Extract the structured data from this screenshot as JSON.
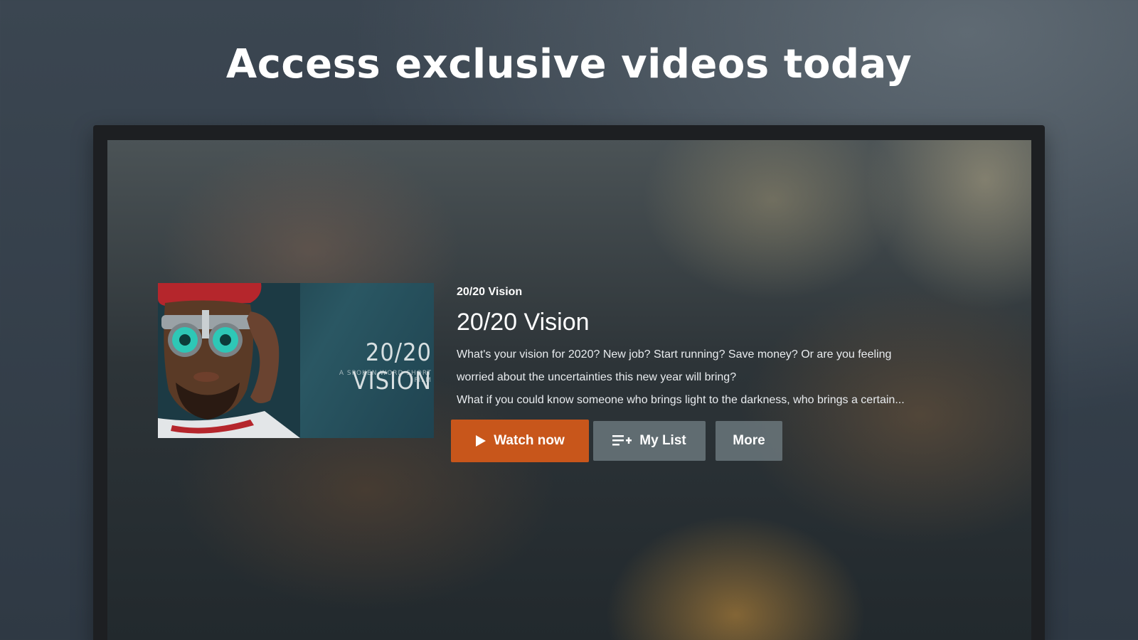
{
  "headline": "Access exclusive videos today",
  "poster": {
    "title_art": "20/20 VISION",
    "subtitle_art": "A SPOKEN WORD SHORT FILM"
  },
  "video": {
    "kicker": "20/20 Vision",
    "title": "20/20 Vision",
    "description_lines": [
      "What's your vision for 2020? New job? Start running? Save money? Or are you feeling",
      "worried about the uncertainties this new year will bring?",
      "What if you could know someone who brings light to the darkness, who brings a certain..."
    ]
  },
  "buttons": {
    "watch_now": "Watch now",
    "my_list": "My List",
    "more": "More"
  },
  "icons": {
    "watch_now": "play-icon",
    "my_list": "playlist-add-icon"
  },
  "colors": {
    "accent": "#c8561b"
  }
}
